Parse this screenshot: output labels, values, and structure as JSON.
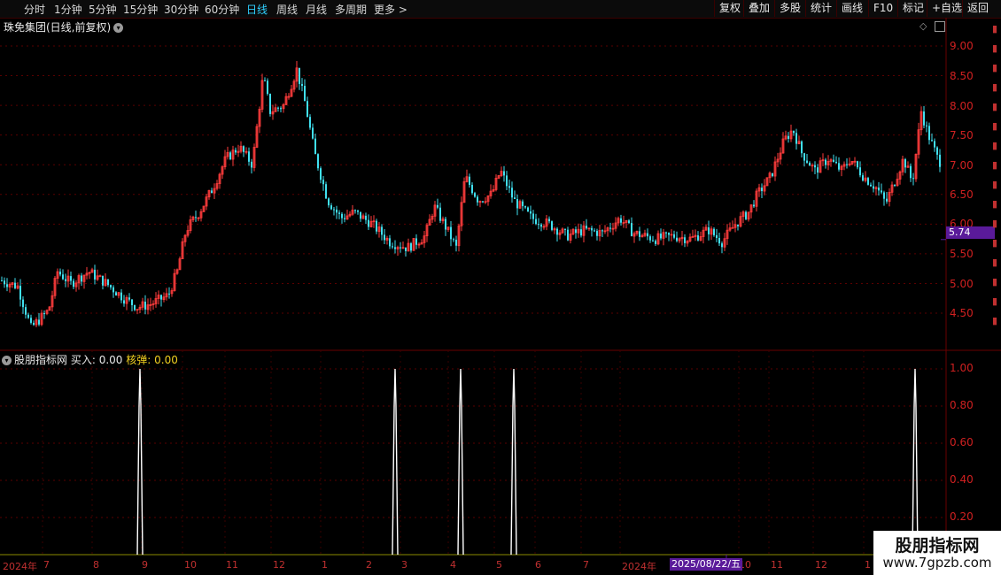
{
  "toolbar": {
    "timeframes": [
      {
        "label": "分时",
        "active": false
      },
      {
        "label": "1分钟",
        "active": false
      },
      {
        "label": "5分钟",
        "active": false
      },
      {
        "label": "15分钟",
        "active": false
      },
      {
        "label": "30分钟",
        "active": false
      },
      {
        "label": "60分钟",
        "active": false
      },
      {
        "label": "日线",
        "active": true
      },
      {
        "label": "周线",
        "active": false
      },
      {
        "label": "月线",
        "active": false
      },
      {
        "label": "多周期",
        "active": false
      },
      {
        "label": "更多 >",
        "active": false
      }
    ],
    "right_buttons": [
      "复权",
      "叠加",
      "多股",
      "统计",
      "画线",
      "F10",
      "标记",
      "+自选",
      "返回"
    ]
  },
  "main_chart": {
    "title": "珠免集团(日线,前复权)",
    "y_ticks": [
      "9.00",
      "8.50",
      "8.00",
      "7.50",
      "7.00",
      "6.50",
      "6.00",
      "5.50",
      "5.00",
      "4.50"
    ],
    "current_price": "5.74"
  },
  "indicator": {
    "name": "股朋指标网",
    "buy_label": "买入:",
    "buy_value": "0.00",
    "hedan_label": "核弹:",
    "hedan_value": "0.00",
    "y_ticks": [
      "1.00",
      "0.80",
      "0.60",
      "0.40",
      "0.20"
    ]
  },
  "x_axis": {
    "labels": [
      "2024年",
      "7",
      "8",
      "9",
      "10",
      "11",
      "12",
      "1",
      "2",
      "3",
      "4",
      "5",
      "6",
      "7",
      "2024年",
      "2025/08/22/五",
      "10",
      "11",
      "12",
      "1"
    ],
    "cursor_date": "2025/08/22/五"
  },
  "watermark": {
    "line1": "股朋指标网",
    "line2": "www.7gpzb.com"
  },
  "colors": {
    "up": "#ff3c3c",
    "down": "#40e0f0",
    "grid": "#5a0000",
    "accent": "#2fd0ff"
  }
}
